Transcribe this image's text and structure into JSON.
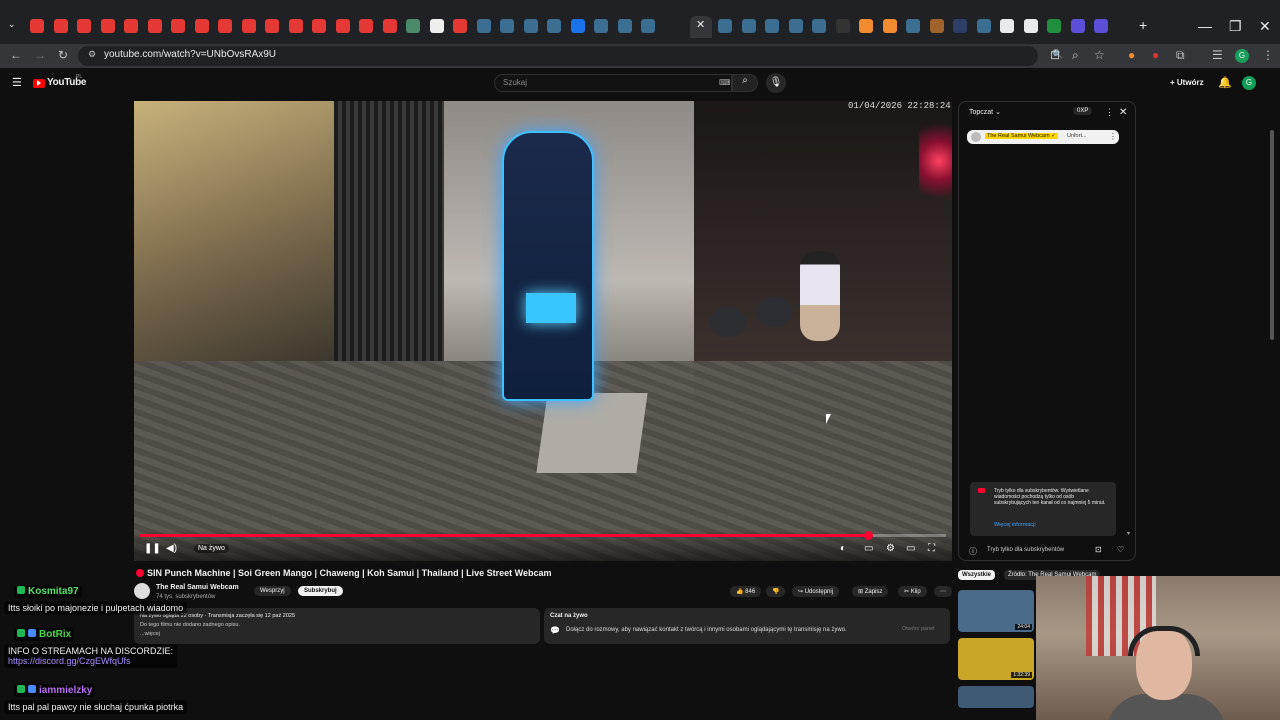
{
  "browser": {
    "url": "youtube.com/watch?v=UNbOvsRAx9U",
    "window_controls": [
      "—",
      "❐",
      "✕"
    ]
  },
  "youtube": {
    "logo_text": "YouTube",
    "logo_sup": "PL",
    "search_placeholder": "Szukaj",
    "create_label": "Utwórz",
    "avatar_letter": "G"
  },
  "player": {
    "timestamp": "01/04/2026 22:28:24",
    "live_label": "Na żywo",
    "progress": 0.903
  },
  "video": {
    "title": "SIN Punch Machine | Soi Green Mango | Chaweng | Koh Samui | Thailand | Live Street Webcam",
    "channel_name": "The Real Samui Webcam",
    "subscribers": "74 tys. subskrybentów",
    "support_label": "Wesprzyj",
    "subscribe_label": "Subskrybuj",
    "likes": "846",
    "share_label": "Udostępnij",
    "save_label": "Zapisz",
    "clip_label": "Klip",
    "description_stats": "Na żywo ogląda 22 osoby · Transmisja zaczęła się 12 paź 2025",
    "description_note": "Do tego filmu nie dodano żadnego opisu.",
    "description_more": "...więcej",
    "live_chat_title": "Czat na żywo",
    "live_chat_text": "Dołącz do rozmowy, aby nawiązać kontakt z twórcą i innymi osobami oglądającymi tę transmisję na żywo.",
    "live_chat_show": "Otwórz panel"
  },
  "chat_panel": {
    "mode": "Topczat",
    "xp": "0XP",
    "pinned_name": "The Real Samui Webcam ✓",
    "pinned_msg": "Unfort...",
    "subonly_text": "Tryb tylko dla subskrybentów. Wyświetlane wiadomości pochodzą tylko od osób subskrybujących ten kanał od co najmniej 5 minut.",
    "subonly_link": "Więcej informacji",
    "footer": "Tryb tylko dla subskrybentów"
  },
  "related": {
    "chip_all": "Wszystkie",
    "chip_source": "Źródło: The Real Samui Webcam",
    "items": [
      {
        "duration": "24:04",
        "color": "#4a6a8a"
      },
      {
        "duration": "1:32:39",
        "color": "#caa628"
      },
      {
        "duration": "",
        "color": "#3f5a74"
      }
    ]
  },
  "twitch_chat": [
    {
      "user": "Kosmita97",
      "color": "#5ee06b",
      "msg": "Itts słoiki po majonezie i pulpetach wiadomo"
    },
    {
      "user": "BotRix",
      "color": "#4ad64a",
      "msg": "INFO O STREAMACH NA DISCORDZIE:",
      "link": "https://discord.gg/CzgEWfqUfs"
    },
    {
      "user": "iammielzky",
      "color": "#b46cf0",
      "msg": "Itts pal pal pawcy nie słuchaj ćpunka piotrka"
    }
  ],
  "colors": {
    "yt_red": "#ff0000",
    "progress_red": "#ff0033",
    "link_blue": "#3ea6ff"
  }
}
